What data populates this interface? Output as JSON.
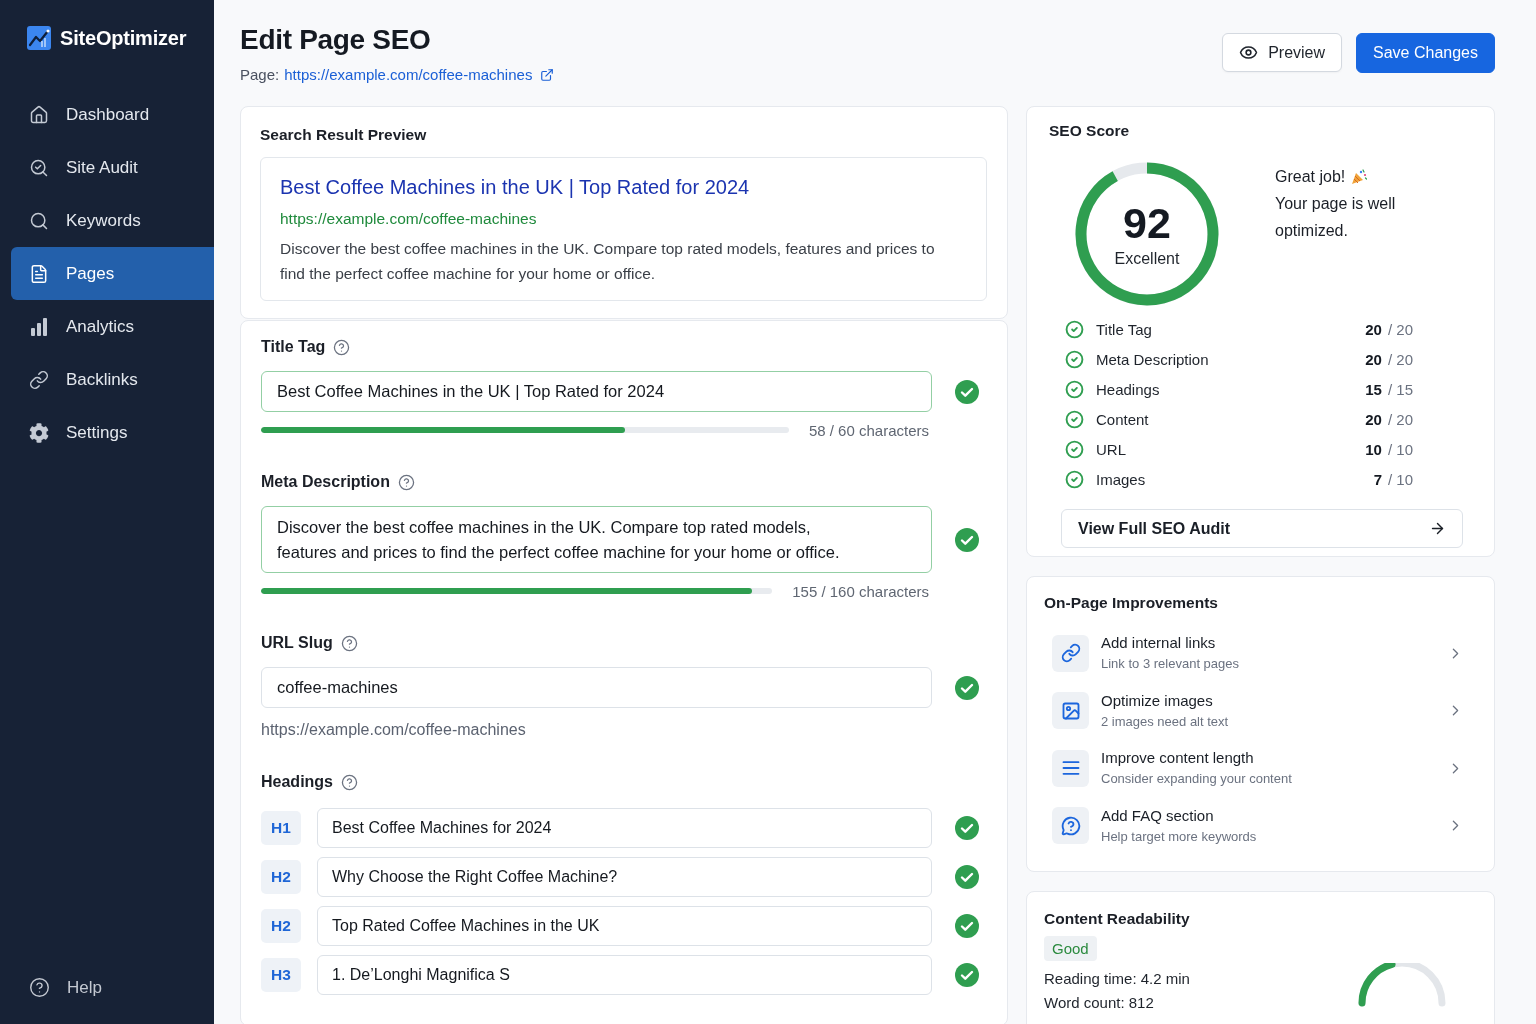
{
  "sidebar": {
    "brand": "SiteOptimizer",
    "items": [
      {
        "label": "Dashboard",
        "selected": false
      },
      {
        "label": "Site Audit",
        "selected": false
      },
      {
        "label": "Keywords",
        "selected": false
      },
      {
        "label": "Pages",
        "selected": true
      },
      {
        "label": "Analytics",
        "selected": false
      },
      {
        "label": "Backlinks",
        "selected": false
      },
      {
        "label": "Settings",
        "selected": false
      }
    ],
    "footer_item": "Help"
  },
  "header": {
    "title": "Edit Page SEO",
    "page_label": "Page:",
    "page_url": "https://example.com/coffee-machines",
    "buttons": [
      {
        "label": "Preview",
        "kind": "secondary"
      },
      {
        "label": "Save Changes",
        "kind": "primary"
      }
    ]
  },
  "search_preview": {
    "heading": "Search Result Preview",
    "title": "Best Coffee Machines in the UK | Top Rated for 2024",
    "url": "https://example.com/coffee-machines",
    "description": "Discover the best coffee machines in the UK. Compare top rated models, features and prices to find the perfect coffee machine for your home or office."
  },
  "fields": [
    {
      "kind": "input",
      "label": "Title Tag",
      "value": "Best Coffee Machines in the UK | Top Rated for 2024",
      "highlighted": true,
      "valid": true,
      "level": 0.69,
      "counter": "58 / 60 characters"
    },
    {
      "kind": "textarea",
      "label": "Meta Description",
      "value": "Discover the best coffee machines in the UK. Compare top rated models, features and prices to find the perfect coffee machine for your home or office.",
      "highlighted": true,
      "valid": true,
      "level": 0.96,
      "counter": "155 / 160 characters"
    },
    {
      "kind": "input",
      "label": "URL Slug",
      "value": "coffee-machines",
      "highlighted": false,
      "valid": true,
      "hint": "https://example.com/coffee-machines"
    }
  ],
  "headings": {
    "label": "Headings",
    "rows": [
      {
        "tag": "H1",
        "value": "Best Coffee Machines for 2024",
        "valid": true
      },
      {
        "tag": "H2",
        "value": "Why Choose the Right Coffee Machine?",
        "valid": true
      },
      {
        "tag": "H2",
        "value": "Top Rated Coffee Machines in the UK",
        "valid": true
      },
      {
        "tag": "H3",
        "value": "1. De’Longhi Magnifica S",
        "valid": true
      }
    ]
  },
  "seo_score": {
    "heading": "SEO Score",
    "score": "92",
    "level": 0.92,
    "rating": "Excellent",
    "message_title": "Great job!",
    "message": "Your page is well optimized.",
    "breakdown": [
      {
        "label": "Title Tag",
        "score": "20",
        "max": "/ 20",
        "passed": true
      },
      {
        "label": "Meta Description",
        "score": "20",
        "max": "/ 20",
        "passed": true
      },
      {
        "label": "Headings",
        "score": "15",
        "max": "/ 15",
        "passed": true
      },
      {
        "label": "Content",
        "score": "20",
        "max": "/ 20",
        "passed": true
      },
      {
        "label": "URL",
        "score": "10",
        "max": "/ 10",
        "passed": true
      },
      {
        "label": "Images",
        "score": "7",
        "max": "/ 10",
        "passed": true
      }
    ],
    "button": "View Full SEO Audit"
  },
  "improvements": {
    "heading": "On-Page Improvements",
    "items": [
      {
        "title": "Add internal links",
        "subtitle": "Link to 3 relevant pages"
      },
      {
        "title": "Optimize images",
        "subtitle": "2 images need alt text"
      },
      {
        "title": "Improve content length",
        "subtitle": "Consider expanding your content"
      },
      {
        "title": "Add FAQ section",
        "subtitle": "Help target more keywords"
      }
    ]
  },
  "readability": {
    "heading": "Content Readability",
    "badge": "Good",
    "reading_time": "Reading time: 4.2 min",
    "word_count": "Word count: 812",
    "level": 0.42
  }
}
